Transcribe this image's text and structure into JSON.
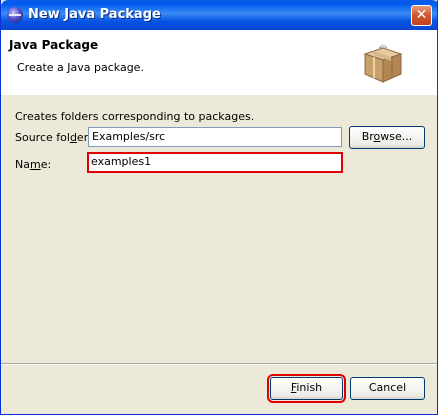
{
  "window": {
    "title": "New Java Package"
  },
  "banner": {
    "title": "Java Package",
    "description": "Create a Java package."
  },
  "form": {
    "intro": "Creates folders corresponding to packages.",
    "source_label_pre": "Source fol",
    "source_label_mnemonic": "d",
    "source_label_post": "er:",
    "source_value": "Examples/src",
    "browse_pre": "Br",
    "browse_mnemonic": "o",
    "browse_post": "wse...",
    "name_label_pre": "Na",
    "name_label_mnemonic": "m",
    "name_label_post": "e:",
    "name_value": "examples1"
  },
  "footer": {
    "finish_mnemonic": "F",
    "finish_post": "inish",
    "cancel_label": "Cancel"
  },
  "icons": [
    "eclipse-app-icon",
    "close-icon",
    "package-icon"
  ],
  "colors": {
    "titlebar": "#0058ee",
    "highlight": "#e00000",
    "dialog": "#ece9d8"
  }
}
